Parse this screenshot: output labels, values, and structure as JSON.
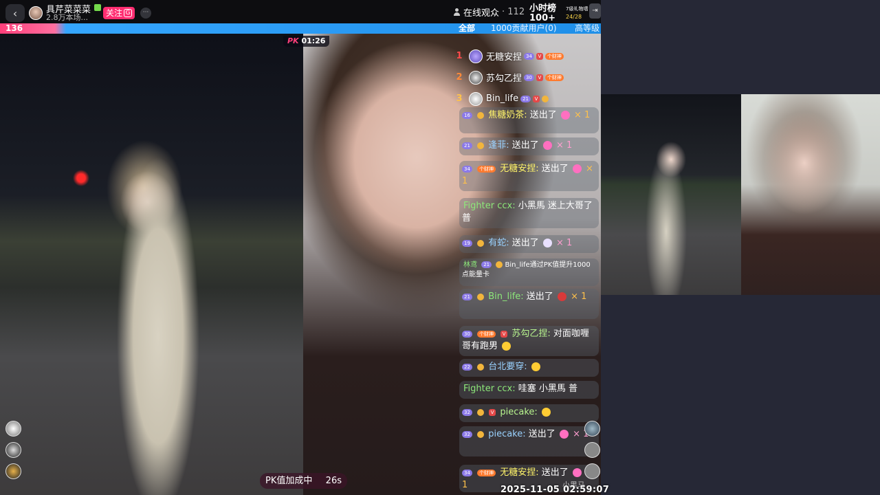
{
  "host": {
    "name": "具芹菜菜菜",
    "sub": "2.8万本场...",
    "follow_label": "关注",
    "follow_icon": "G",
    "more_label": "···"
  },
  "viewers": {
    "label": "在线观众",
    "count": "· 112"
  },
  "hourly_rank": {
    "label": "小时榜",
    "value": "100+"
  },
  "gift_goal": {
    "label": "7级礼物墙",
    "progress": "24/28"
  },
  "pk_bar": {
    "left_score": "136",
    "tab_all": "全部",
    "tab_contrib": "1000贡献用户(0)",
    "tab_high": "高等级"
  },
  "pk_timer": {
    "mark": "PK",
    "time": "01:26"
  },
  "ranking": [
    {
      "rank": "1",
      "name": "无糖安捏",
      "level": "34",
      "tag": "个财神"
    },
    {
      "rank": "2",
      "name": "苏勾乙捏",
      "level": "30",
      "tag": "个财神"
    },
    {
      "rank": "3",
      "name": "Bin_life",
      "level": "21",
      "tag": ""
    }
  ],
  "chat": [
    {
      "level": "16",
      "user": "焦糖奶茶:",
      "text": "送出了",
      "suffix": "× 1"
    },
    {
      "level": "21",
      "user": "逢菲:",
      "text": "送出了",
      "suffix": "× 1"
    },
    {
      "level": "34",
      "user": "无糖安捏:",
      "text": "送出了",
      "suffix": "× 1"
    },
    {
      "level": "",
      "user": "Fighter ccx:",
      "text": "小黑馬 迷上大哥了 普",
      "suffix": ""
    },
    {
      "level": "19",
      "user": "有蛇:",
      "text": "送出了",
      "suffix": "× 1"
    },
    {
      "level": "21",
      "user": "林鸢",
      "text": "Bin_life通过PK值提升1000点能量卡",
      "suffix": ""
    },
    {
      "level": "21",
      "user": "Bin_life:",
      "text": "送出了",
      "suffix": "× 1"
    },
    {
      "level": "30",
      "user": "苏勾乙捏:",
      "text": "对面咖喱哥有跑男",
      "suffix": ""
    },
    {
      "level": "22",
      "user": "台北要穿:",
      "text": "",
      "suffix": ""
    },
    {
      "level": "",
      "user": "Fighter ccx:",
      "text": "哇塞 小黑馬 普",
      "suffix": ""
    },
    {
      "level": "32",
      "user": "piecake:",
      "text": "",
      "suffix": ""
    },
    {
      "level": "32",
      "user": "piecake:",
      "text": "送出了",
      "suffix": "× 1"
    },
    {
      "level": "34",
      "user": "无糖安捏:",
      "text": "送出了",
      "suffix": "× 1"
    }
  ],
  "pk_boost": {
    "label": "PK值加成中",
    "seconds": "26s"
  },
  "timestamp": "2025-11-05 02:59:07",
  "watermark": "小黑马",
  "colors": {
    "pk_pink": "#ff3f7a",
    "pk_blue": "#1f8fe8",
    "follow": "#ff2d71",
    "background": "#262836"
  }
}
